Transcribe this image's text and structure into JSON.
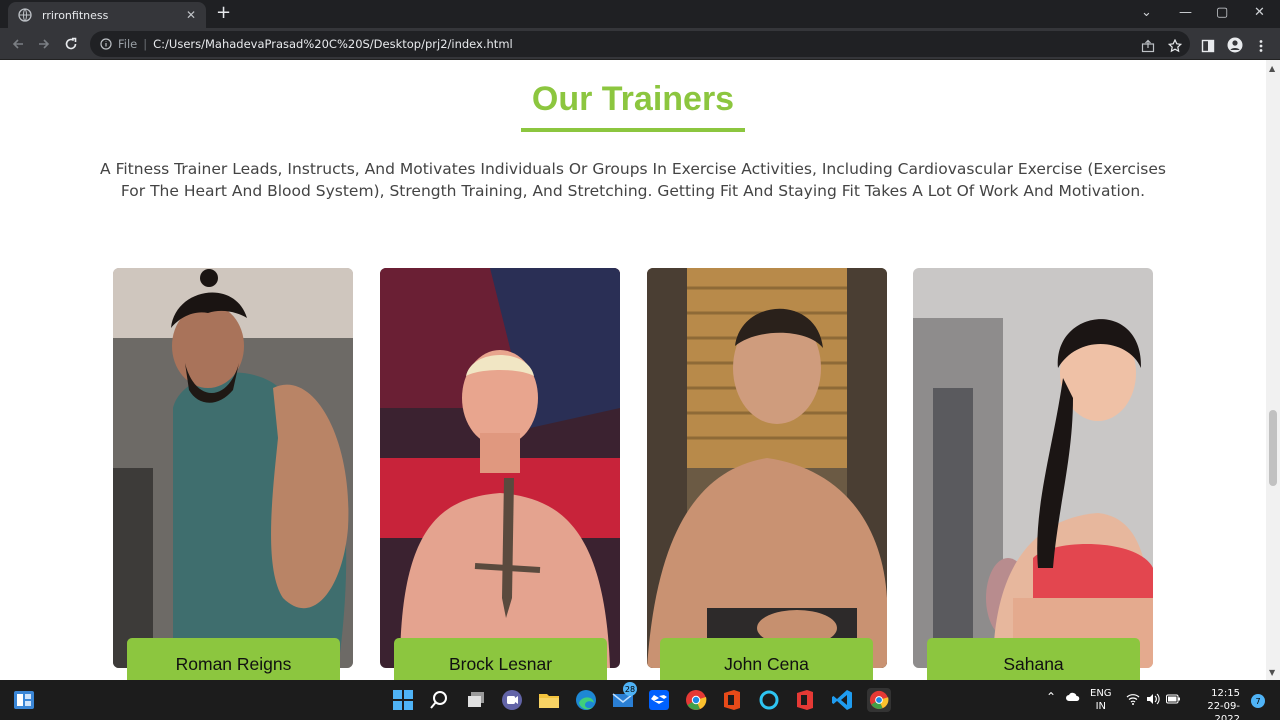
{
  "browser": {
    "tab_title": "rrironfitness",
    "address_scheme": "File",
    "address_url": "C:/Users/MahadevaPrasad%20C%20S/Desktop/prj2/index.html"
  },
  "page": {
    "section_title": "Our Trainers",
    "intro": "A Fitness Trainer Leads, Instructs, And Motivates Individuals Or Groups In Exercise Activities, Including Cardiovascular Exercise (Exercises For The Heart And Blood System), Strength Training, And Stretching. Getting Fit And Staying Fit Takes A Lot Of Work And Motivation.",
    "trainers": [
      {
        "name": "Roman Reigns"
      },
      {
        "name": "Brock Lesnar"
      },
      {
        "name": "John Cena"
      },
      {
        "name": "Sahana"
      }
    ],
    "accent_color": "#8cc63f"
  },
  "taskbar": {
    "language": "ENG",
    "region": "IN",
    "time": "12:15",
    "date": "22-09-2022",
    "mail_badge": "28",
    "notification_count": "7"
  }
}
